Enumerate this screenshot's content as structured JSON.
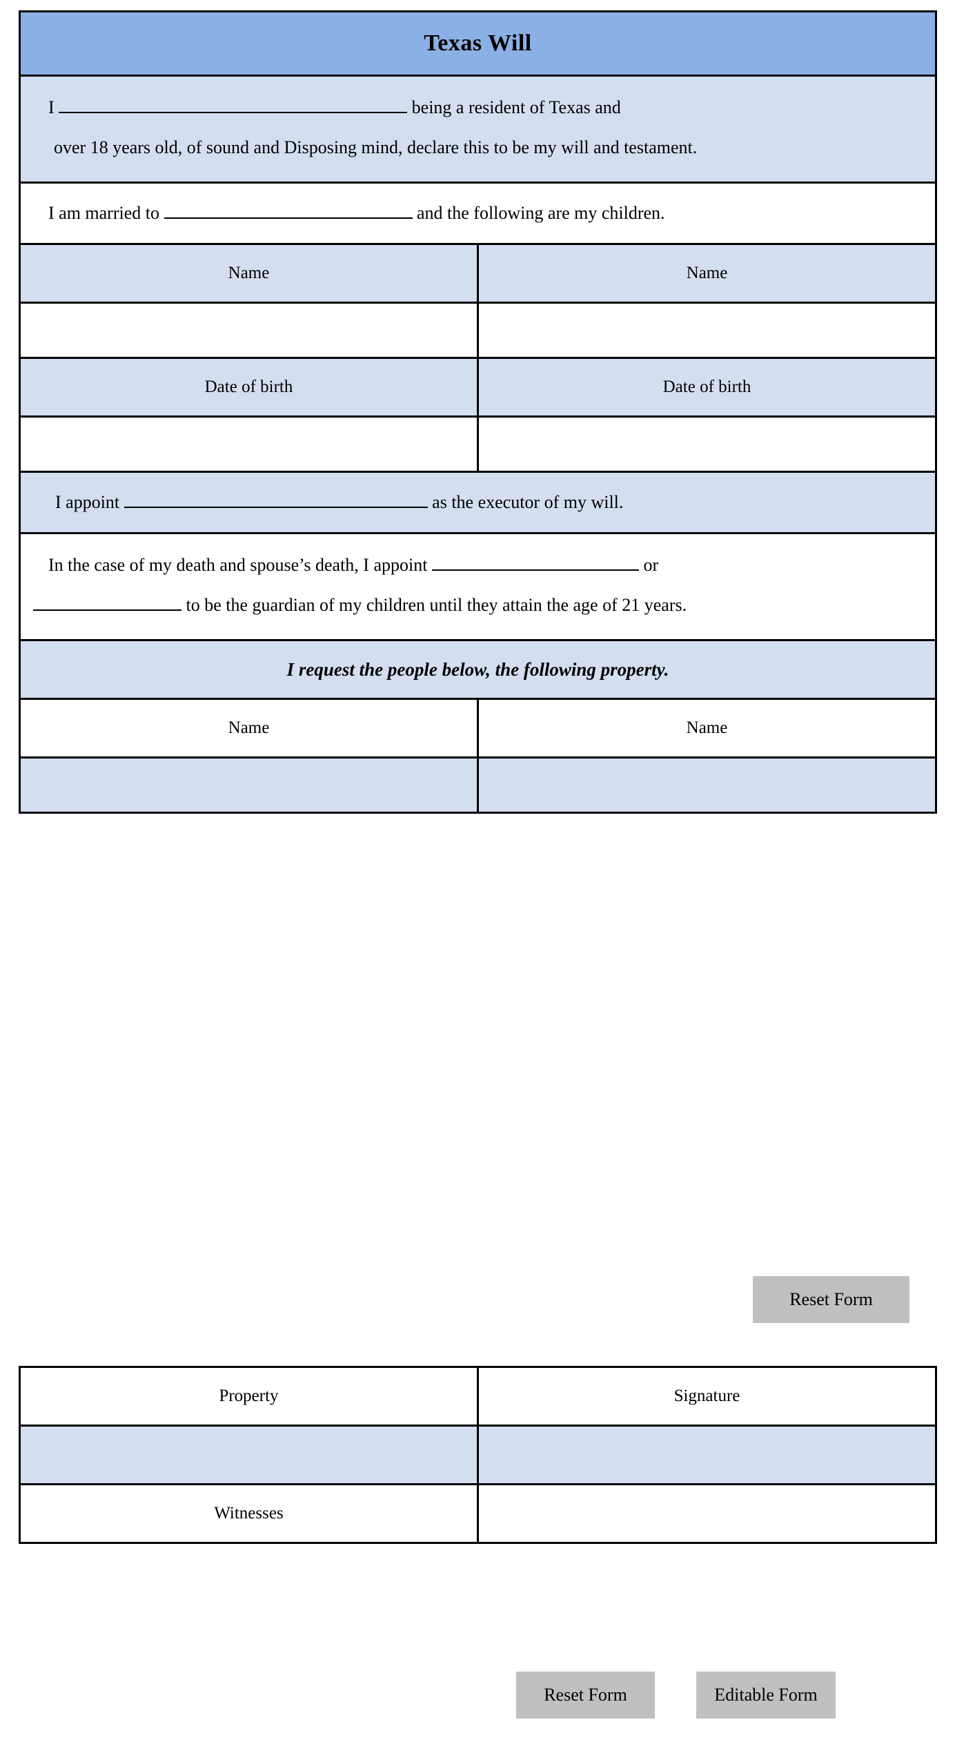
{
  "document": {
    "title": "Texas Will"
  },
  "colors": {
    "header_blue": "#8BB0E5",
    "tint_blue": "#D3DEF0",
    "button_gray": "#C0C0C0",
    "border": "#000000"
  },
  "declaration": {
    "lead": "I",
    "after_blank": "being a resident of Texas and",
    "line2": "over 18 years old, of sound and   Disposing mind, declare this to be my will and testament."
  },
  "marriage": {
    "lead": "I am married to",
    "after_blank": "and the following are my children."
  },
  "children_table": {
    "headers_name": [
      "Name",
      "Name"
    ],
    "name_values": [
      "",
      ""
    ],
    "headers_dob": [
      "Date of birth",
      "Date of birth"
    ],
    "dob_values": [
      "",
      ""
    ]
  },
  "executor": {
    "lead": "I appoint",
    "after_blank": "as the executor of my will."
  },
  "guardian": {
    "line1_lead": "In the case of my death and spouse’s death, I appoint",
    "line1_tail": "or",
    "line2_tail": "to be the guardian of my children until they attain the age of 21 years."
  },
  "property_request": {
    "heading": "I request the people below, the following property.",
    "headers": [
      "Name",
      "Name"
    ],
    "values": [
      "",
      ""
    ]
  },
  "signature_table": {
    "headers": [
      "Property",
      "Signature"
    ],
    "values": [
      "",
      ""
    ],
    "witness_label": "Witnesses",
    "witness_value": ""
  },
  "buttons": {
    "reset_top": "Reset Form",
    "reset_bottom": "Reset Form",
    "editable_bottom": "Editable Form"
  }
}
